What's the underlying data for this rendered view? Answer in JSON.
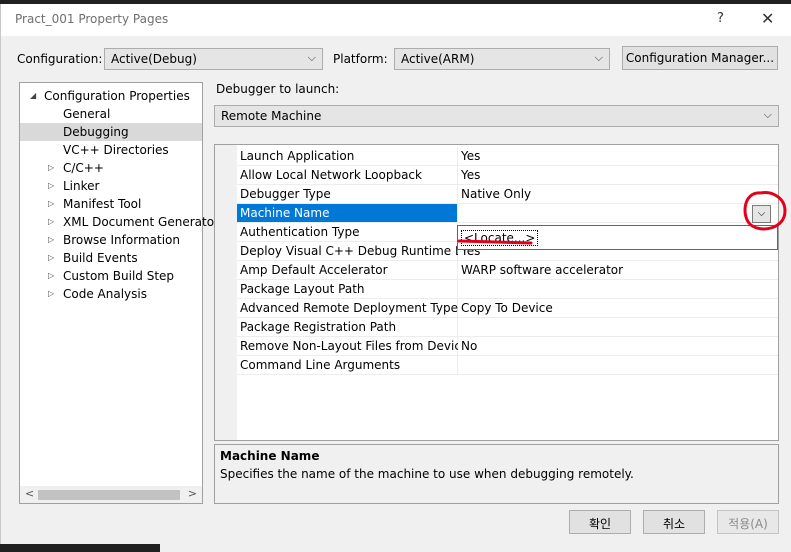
{
  "window": {
    "title": "Pract_001 Property Pages",
    "help": "?",
    "close": "✕"
  },
  "config": {
    "configuration_label": "Configuration:",
    "configuration_value": "Active(Debug)",
    "platform_label": "Platform:",
    "platform_value": "Active(ARM)",
    "manager_button": "Configuration Manager..."
  },
  "tree": {
    "items": [
      {
        "label": "Configuration Properties",
        "expander": "◢"
      },
      {
        "label": "General"
      },
      {
        "label": "Debugging"
      },
      {
        "label": "VC++ Directories"
      },
      {
        "label": "C/C++",
        "expander": "▷"
      },
      {
        "label": "Linker",
        "expander": "▷"
      },
      {
        "label": "Manifest Tool",
        "expander": "▷"
      },
      {
        "label": "XML Document Generator",
        "expander": "▷"
      },
      {
        "label": "Browse Information",
        "expander": "▷"
      },
      {
        "label": "Build Events",
        "expander": "▷"
      },
      {
        "label": "Custom Build Step",
        "expander": "▷"
      },
      {
        "label": "Code Analysis",
        "expander": "▷"
      }
    ]
  },
  "debugger": {
    "label": "Debugger to launch:",
    "value": "Remote Machine"
  },
  "properties": [
    {
      "name": "Launch Application",
      "value": "Yes"
    },
    {
      "name": "Allow Local Network Loopback",
      "value": "Yes"
    },
    {
      "name": "Debugger Type",
      "value": "Native Only"
    },
    {
      "name": "Machine Name",
      "value": ""
    },
    {
      "name": "Authentication Type",
      "value": ""
    },
    {
      "name": "Deploy Visual C++ Debug Runtime Libraries",
      "value": "Yes"
    },
    {
      "name": "Amp Default Accelerator",
      "value": "WARP software accelerator"
    },
    {
      "name": "Package Layout Path",
      "value": ""
    },
    {
      "name": "Advanced Remote Deployment Type",
      "value": "Copy To Device"
    },
    {
      "name": "Package Registration Path",
      "value": ""
    },
    {
      "name": "Remove Non-Layout Files from Device",
      "value": "No"
    },
    {
      "name": "Command Line Arguments",
      "value": ""
    }
  ],
  "dropdown": {
    "option": "<Locate...>"
  },
  "description": {
    "title": "Machine Name",
    "text": "Specifies the name of the machine to use when debugging remotely."
  },
  "buttons": {
    "ok": "확인",
    "cancel": "취소",
    "apply": "적용(A)"
  },
  "icons": {
    "chevron": "⌵",
    "scroll_left": "<",
    "scroll_right": ">"
  },
  "annotation_color": "#e3001b"
}
